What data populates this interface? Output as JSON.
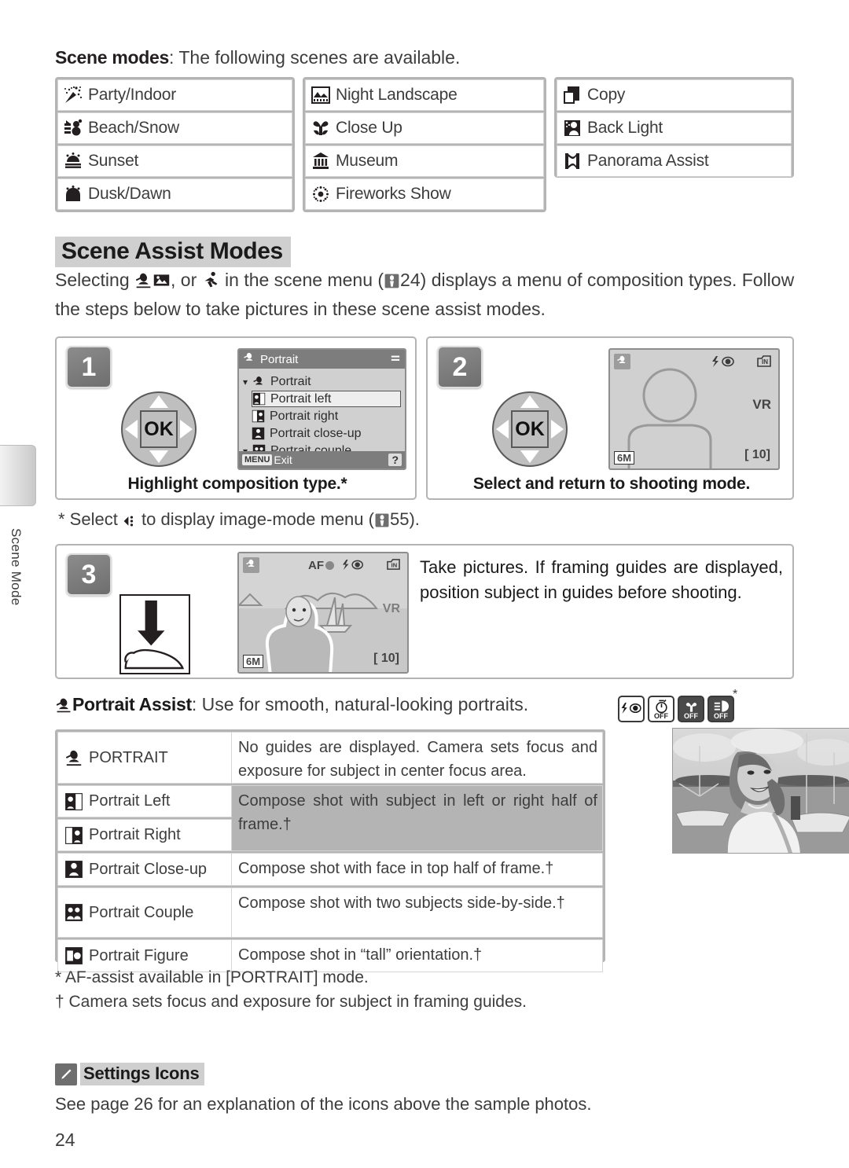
{
  "sidebar": {
    "label": "Scene Mode"
  },
  "page_number": "24",
  "intro": {
    "bold": "Scene modes",
    "rest": ": The following scenes are available."
  },
  "scene_modes": {
    "columns": [
      [
        {
          "icon": "party-indoor-icon",
          "label": "Party/Indoor"
        },
        {
          "icon": "beach-snow-icon",
          "label": "Beach/Snow"
        },
        {
          "icon": "sunset-icon",
          "label": "Sunset"
        },
        {
          "icon": "dusk-dawn-icon",
          "label": "Dusk/Dawn"
        }
      ],
      [
        {
          "icon": "night-landscape-icon",
          "label": "Night Landscape"
        },
        {
          "icon": "close-up-icon",
          "label": "Close Up"
        },
        {
          "icon": "museum-icon",
          "label": "Museum"
        },
        {
          "icon": "fireworks-show-icon",
          "label": "Fireworks Show"
        }
      ],
      [
        {
          "icon": "copy-icon",
          "label": "Copy"
        },
        {
          "icon": "back-light-icon",
          "label": "Back Light"
        },
        {
          "icon": "panorama-assist-icon",
          "label": "Panorama Assist"
        }
      ]
    ]
  },
  "section": {
    "heading": "Scene Assist Modes",
    "body_1": "Selecting ",
    "body_2": ", or ",
    "body_3": " in the scene menu (",
    "page_ref": "24",
    "body_4": ") displays a menu of composition types.  Follow the steps below to take pictures in these scene assist modes."
  },
  "steps": [
    {
      "number": "1",
      "caption": "Highlight composition type.*",
      "lcd": {
        "title": "Portrait",
        "items": [
          {
            "label": "Portrait",
            "icon": "portrait-icon",
            "selected": false,
            "chevron": true
          },
          {
            "label": "Portrait left",
            "icon": "portrait-left-icon",
            "selected": true
          },
          {
            "label": "Portrait right",
            "icon": "portrait-right-icon",
            "selected": false
          },
          {
            "label": "Portrait close-up",
            "icon": "portrait-closeup-icon",
            "selected": false
          },
          {
            "label": "Portrait couple",
            "icon": "portrait-couple-icon",
            "selected": false
          }
        ],
        "footer_button": "MENU",
        "footer_label": "Exit",
        "help": "?"
      }
    },
    {
      "number": "2",
      "caption": "Select and return to shooting mode.",
      "lcd": {
        "mode_icon": "portrait-mode-icon",
        "flash": "flash-redeye-icon",
        "memory": "internal-memory-icon",
        "vr": "VR",
        "image_size": "6M",
        "frames": "10"
      }
    },
    {
      "number": "3",
      "text": "Take pictures.  If framing guides are displayed, position subject in guides before shooting.",
      "lcd": {
        "mode_icon": "portrait-mode-icon",
        "af": "AF",
        "flash": "flash-redeye-icon",
        "memory": "internal-memory-icon",
        "vr": "VR",
        "image_size": "6M",
        "frames": "10"
      }
    }
  ],
  "step_footnote": {
    "pre": "* Select ",
    "icon": "multi-selector-left-icon",
    "mid": " to display image-mode menu (",
    "page_ref": "55",
    "post": ")."
  },
  "portrait_assist": {
    "heading_bold": "Portrait Assist",
    "heading_rest": ": Use for smooth, natural-looking portraits.",
    "settings_icons": [
      {
        "name": "flash-redeye-icon",
        "off": "",
        "dark": false
      },
      {
        "name": "self-timer-icon",
        "off": "OFF",
        "dark": false
      },
      {
        "name": "macro-icon",
        "off": "OFF",
        "dark": true
      },
      {
        "name": "af-assist-icon",
        "off": "OFF",
        "dark": true
      }
    ],
    "settings_asterisk": "*",
    "rows": [
      {
        "icon": "portrait-icon",
        "mode": "PORTRAIT",
        "desc": "No guides are displayed.  Camera sets focus and exposure for subject in center focus area."
      },
      {
        "icon": "portrait-left-icon",
        "mode": "Portrait Left",
        "desc": "Compose shot with subject in left or right half of frame.†"
      },
      {
        "icon": "portrait-right-icon",
        "mode": "Portrait Right",
        "desc": ""
      },
      {
        "icon": "portrait-closeup-icon",
        "mode": "Portrait Close-up",
        "desc": "Compose shot with face in top half of frame.†"
      },
      {
        "icon": "portrait-couple-icon",
        "mode": "Portrait Couple",
        "desc": "Compose shot with two subjects side-by-side.†"
      },
      {
        "icon": "portrait-figure-icon",
        "mode": "Portrait Figure",
        "desc": "Compose shot in “tall” orientation.†"
      }
    ]
  },
  "footnotes": {
    "star": "*  AF-assist available in [PORTRAIT] mode.",
    "dagger": "† Camera sets focus and exposure for subject in framing guides."
  },
  "settings_icons_note": {
    "title": "Settings Icons",
    "body": "See page 26 for an explanation of the icons above the sample photos."
  },
  "colors": {
    "table_border": "#b4b4b4",
    "heading_highlight": "#cfcfcf",
    "badge": "#7a7a7a",
    "lcd_bg": "#d0d0d0"
  }
}
